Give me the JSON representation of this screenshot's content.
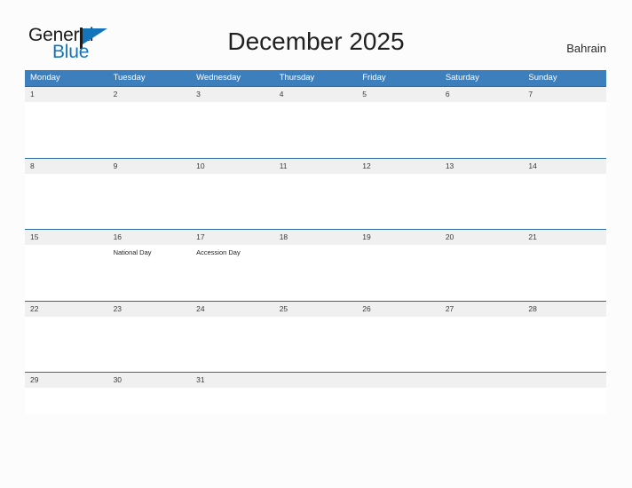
{
  "header": {
    "logo": {
      "word_one": "General",
      "word_two": "Blue",
      "mark": "flag-triangle-icon"
    },
    "title": "December 2025",
    "country": "Bahrain"
  },
  "colors": {
    "header_blue": "#3d7ebd",
    "rule_blue": "#2e6da4",
    "date_band_gray": "#f0f0f0",
    "logo_blue": "#1474bb",
    "page_background": "#fcfcfc"
  },
  "calendar": {
    "weekdays": [
      "Monday",
      "Tuesday",
      "Wednesday",
      "Thursday",
      "Friday",
      "Saturday",
      "Sunday"
    ],
    "weeks": [
      {
        "days": [
          {
            "date": "1",
            "event": ""
          },
          {
            "date": "2",
            "event": ""
          },
          {
            "date": "3",
            "event": ""
          },
          {
            "date": "4",
            "event": ""
          },
          {
            "date": "5",
            "event": ""
          },
          {
            "date": "6",
            "event": ""
          },
          {
            "date": "7",
            "event": ""
          }
        ]
      },
      {
        "days": [
          {
            "date": "8",
            "event": ""
          },
          {
            "date": "9",
            "event": ""
          },
          {
            "date": "10",
            "event": ""
          },
          {
            "date": "11",
            "event": ""
          },
          {
            "date": "12",
            "event": ""
          },
          {
            "date": "13",
            "event": ""
          },
          {
            "date": "14",
            "event": ""
          }
        ]
      },
      {
        "days": [
          {
            "date": "15",
            "event": ""
          },
          {
            "date": "16",
            "event": "National Day"
          },
          {
            "date": "17",
            "event": "Accession Day"
          },
          {
            "date": "18",
            "event": ""
          },
          {
            "date": "19",
            "event": ""
          },
          {
            "date": "20",
            "event": ""
          },
          {
            "date": "21",
            "event": ""
          }
        ]
      },
      {
        "days": [
          {
            "date": "22",
            "event": ""
          },
          {
            "date": "23",
            "event": ""
          },
          {
            "date": "24",
            "event": ""
          },
          {
            "date": "25",
            "event": ""
          },
          {
            "date": "26",
            "event": ""
          },
          {
            "date": "27",
            "event": ""
          },
          {
            "date": "28",
            "event": ""
          }
        ]
      },
      {
        "days": [
          {
            "date": "29",
            "event": ""
          },
          {
            "date": "30",
            "event": ""
          },
          {
            "date": "31",
            "event": ""
          },
          {
            "date": "",
            "event": ""
          },
          {
            "date": "",
            "event": ""
          },
          {
            "date": "",
            "event": ""
          },
          {
            "date": "",
            "event": ""
          }
        ]
      }
    ]
  }
}
